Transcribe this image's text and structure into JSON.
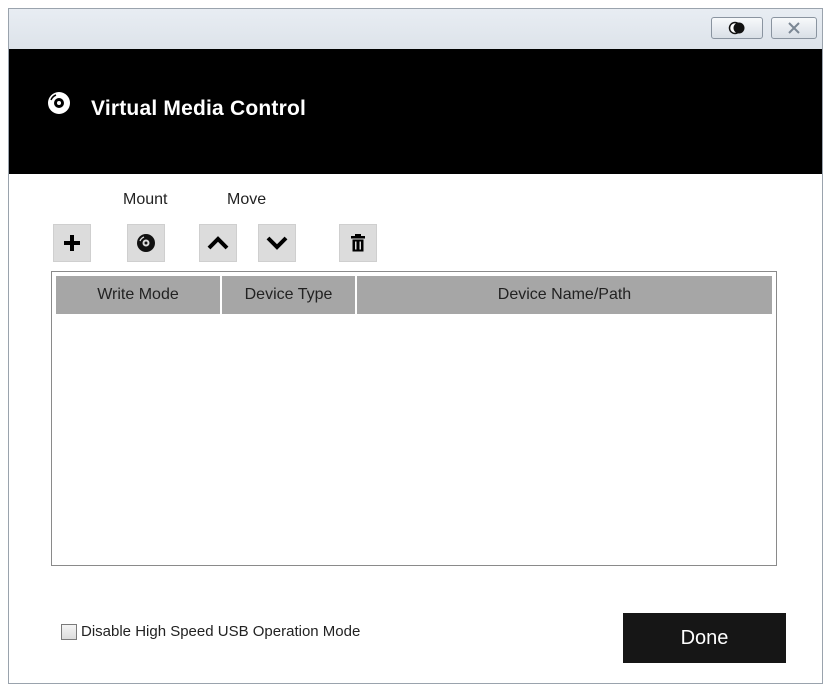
{
  "header": {
    "title": "Virtual Media Control",
    "icon": "disc-icon"
  },
  "titlebar": {
    "buttons": [
      "theme-toggle-icon",
      "close-icon"
    ]
  },
  "toolbar": {
    "mount_label": "Mount",
    "move_label": "Move",
    "buttons": [
      "plus-icon",
      "mount-disc-icon",
      "chevron-up-icon",
      "chevron-down-icon",
      "trash-icon"
    ]
  },
  "table": {
    "columns": [
      "Write Mode",
      "Device Type",
      "Device Name/Path"
    ],
    "rows": []
  },
  "footer": {
    "checkbox_label": "Disable High Speed USB Operation Mode",
    "checkbox_checked": false,
    "done_label": "Done"
  },
  "colors": {
    "header_bg": "#000000",
    "table_header_bg": "#a6a6a6",
    "button_bg": "#dcdcdc",
    "done_bg": "#161616"
  }
}
